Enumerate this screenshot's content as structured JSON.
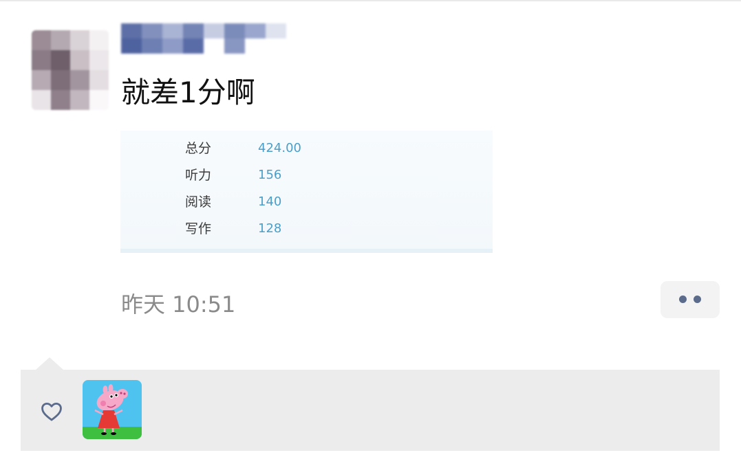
{
  "post": {
    "author_name": "",
    "text": "就差1分啊",
    "timestamp": "昨天 10:51"
  },
  "score_card": {
    "rows": [
      {
        "label": "总分",
        "value": "424.00"
      },
      {
        "label": "听力",
        "value": "156"
      },
      {
        "label": "阅读",
        "value": "140"
      },
      {
        "label": "写作",
        "value": "128"
      }
    ]
  },
  "actions": {
    "more_icon": "two-dots-icon"
  },
  "likes": {
    "icon": "heart-outline-icon",
    "likers": [
      {
        "avatar": "peppa-pig-avatar"
      }
    ]
  },
  "colors": {
    "score_value": "#4a9ec9",
    "timestamp": "#8a8a8a",
    "likes_bg": "#ececec",
    "more_dots": "#5b6b8c"
  }
}
